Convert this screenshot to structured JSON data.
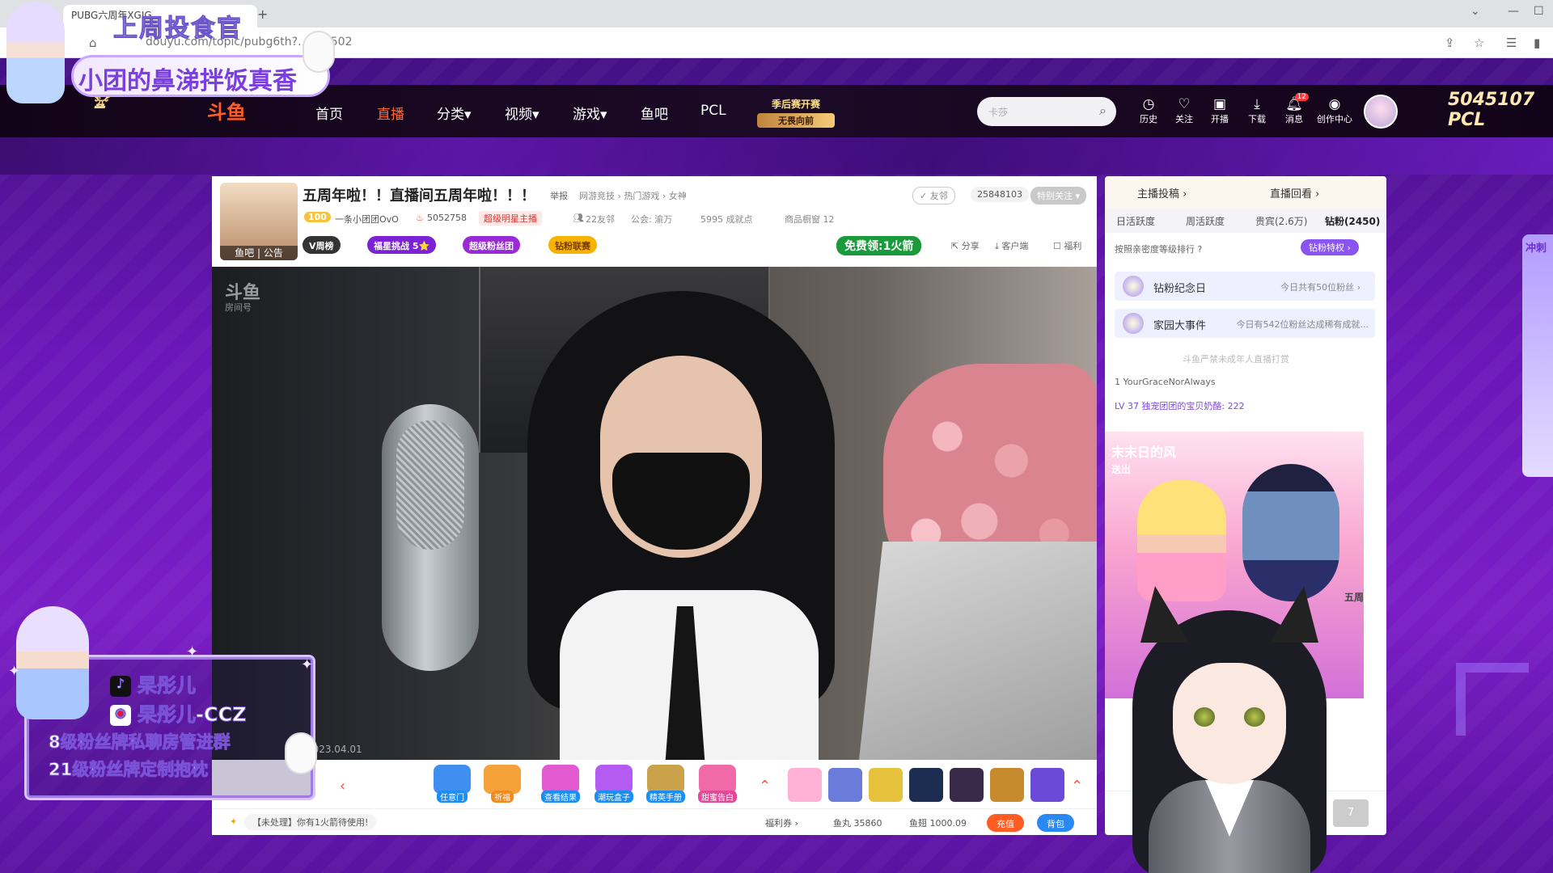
{
  "browser": {
    "tab_title": "PUBG六周年XGIG…",
    "url": "douyu.com/topic/pubg6th?…615502"
  },
  "header": {
    "logo": "斗鱼",
    "nav": [
      {
        "label": "首页"
      },
      {
        "label": "直播"
      },
      {
        "label": "分类▾"
      },
      {
        "label": "视频▾"
      },
      {
        "label": "游戏▾"
      },
      {
        "label": "鱼吧"
      },
      {
        "label": "PCL"
      }
    ],
    "promo": {
      "title": "季后赛开赛",
      "sub": "无畏向前"
    },
    "search_placeholder": "卡莎",
    "buttons": [
      {
        "label": "历史",
        "icon": "clock-icon",
        "glyph": "◷"
      },
      {
        "label": "关注",
        "icon": "heart-icon",
        "glyph": "♡"
      },
      {
        "label": "开播",
        "icon": "camera-icon",
        "glyph": "▣"
      },
      {
        "label": "下载",
        "icon": "download-icon",
        "glyph": "⤓"
      },
      {
        "label": "消息",
        "icon": "bell-icon",
        "glyph": "🔔︎",
        "badge": "12"
      },
      {
        "label": "创作中心",
        "icon": "bulb-icon",
        "glyph": "◉"
      }
    ],
    "right_brand": "5045107 PCL"
  },
  "overlay_top": {
    "line1": "上周投食官",
    "line2": "小团的鼻涕拌饭真香"
  },
  "room": {
    "title": "五周年啦！！直播间五周年啦！！！",
    "report": "举报",
    "category": "网游竞技 › 热门游戏 › 女神",
    "share_btn": "✓ 友邻",
    "follow_count": "25848103",
    "follow_btn": "特别关注 ▾",
    "level": "100",
    "anchor": "一条小团团OvO",
    "hot": "5052758",
    "badge": "超级明星主播",
    "friends": "22友邻",
    "guild": "公会: 渝万",
    "achievements": "5995 成就点",
    "shop": "商品橱窗 12",
    "avatar_label": "鱼吧 | 公告",
    "pills": [
      "V周榜",
      "福星挑战  5⭐",
      "超级粉丝团",
      "钻粉联赛"
    ],
    "free_rocket": "免费领:1火箭",
    "tools": [
      "分享",
      "客户端",
      "福利"
    ],
    "watermark": "斗鱼",
    "watermark_sub": "房间号",
    "video_date": "22 | 2023.04.01"
  },
  "gifts": [
    {
      "label": "任意门",
      "color": "#3f8ef0"
    },
    {
      "label": "祈福",
      "color": "#f5a23a"
    },
    {
      "label": "查看结果",
      "color": "#e25ad0"
    },
    {
      "label": "潮玩盒子",
      "color": "#b45cf2"
    },
    {
      "label": "精英手册",
      "color": "#c9a24a"
    },
    {
      "label": "甜蜜告白",
      "color": "#f06aa8"
    }
  ],
  "bottom": {
    "notice": "【未处理】你有1火箭待使用!",
    "welfare": "福利券 ›",
    "fishball": "鱼丸 35860",
    "fishwing": "鱼翅 1000.09",
    "recharge": "充值",
    "bag": "背包"
  },
  "right": {
    "top": [
      "主播投稿 ›",
      "直播回看 ›"
    ],
    "tabs": [
      "日活跃度",
      "周活跃度",
      "贵宾(2.6万)",
      "钻粉(2450)"
    ],
    "rank_hint": "按照亲密度等级排行 ?",
    "diamond_btn": "钻粉特权 ›",
    "box1": {
      "title": "钻粉纪念日",
      "right": "今日共有50位粉丝 ›"
    },
    "box2": {
      "title": "家园大事件",
      "right": "今日有542位粉丝达成稀有成就..."
    },
    "notice": "斗鱼严禁未成年人直播打赏",
    "rank1": "1   YourGraceNorAlways",
    "chat_line": "LV 37   独宠团团的宝贝奶酪:  222",
    "ad_title": "末末日的风",
    "ad_sub": "送出",
    "ad_side": "五周",
    "send": "7"
  },
  "overlay_bl": {
    "douyin": "杲彤儿",
    "weibo": "杲彤儿-CCZ",
    "line3": "8级粉丝牌私聊房管进群",
    "line4": "21级粉丝牌定制抱枕"
  },
  "right_side": "冲刺"
}
